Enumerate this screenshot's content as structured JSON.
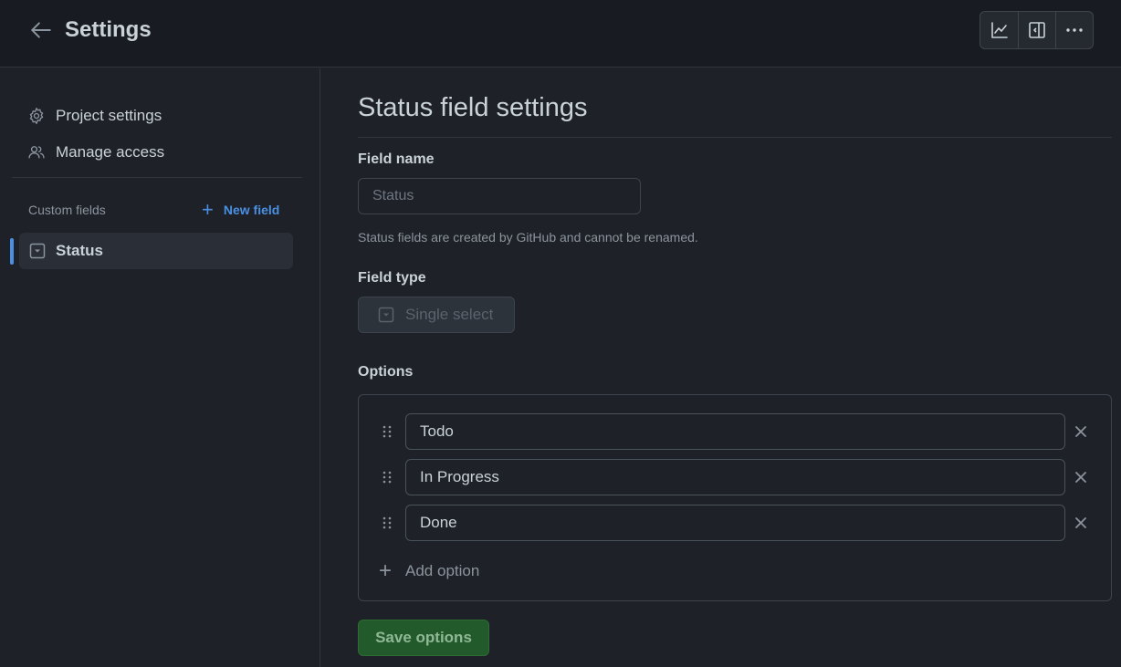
{
  "header": {
    "title": "Settings",
    "icons": [
      "arrow-left-icon",
      "graph-icon",
      "sidebar-panel-icon",
      "kebab-horizontal-icon"
    ]
  },
  "sidebar": {
    "nav": [
      {
        "label": "Project settings",
        "icon": "gear-icon"
      },
      {
        "label": "Manage access",
        "icon": "people-icon"
      }
    ],
    "custom_fields_label": "Custom fields",
    "new_field_label": "New field",
    "fields": [
      {
        "label": "Status",
        "icon": "single-select-icon",
        "active": true
      }
    ]
  },
  "main": {
    "title": "Status field settings",
    "field_name_label": "Field name",
    "field_name_placeholder": "Status",
    "field_name_hint": "Status fields are created by GitHub and cannot be renamed.",
    "field_type_label": "Field type",
    "field_type_value": "Single select",
    "options_label": "Options",
    "options": [
      "Todo",
      "In Progress",
      "Done"
    ],
    "add_option_label": "Add option",
    "save_label": "Save options"
  },
  "colors": {
    "background": "#1e2228",
    "header": "#181b21",
    "accent": "#4a90e2",
    "save_button": "#235a2b"
  }
}
